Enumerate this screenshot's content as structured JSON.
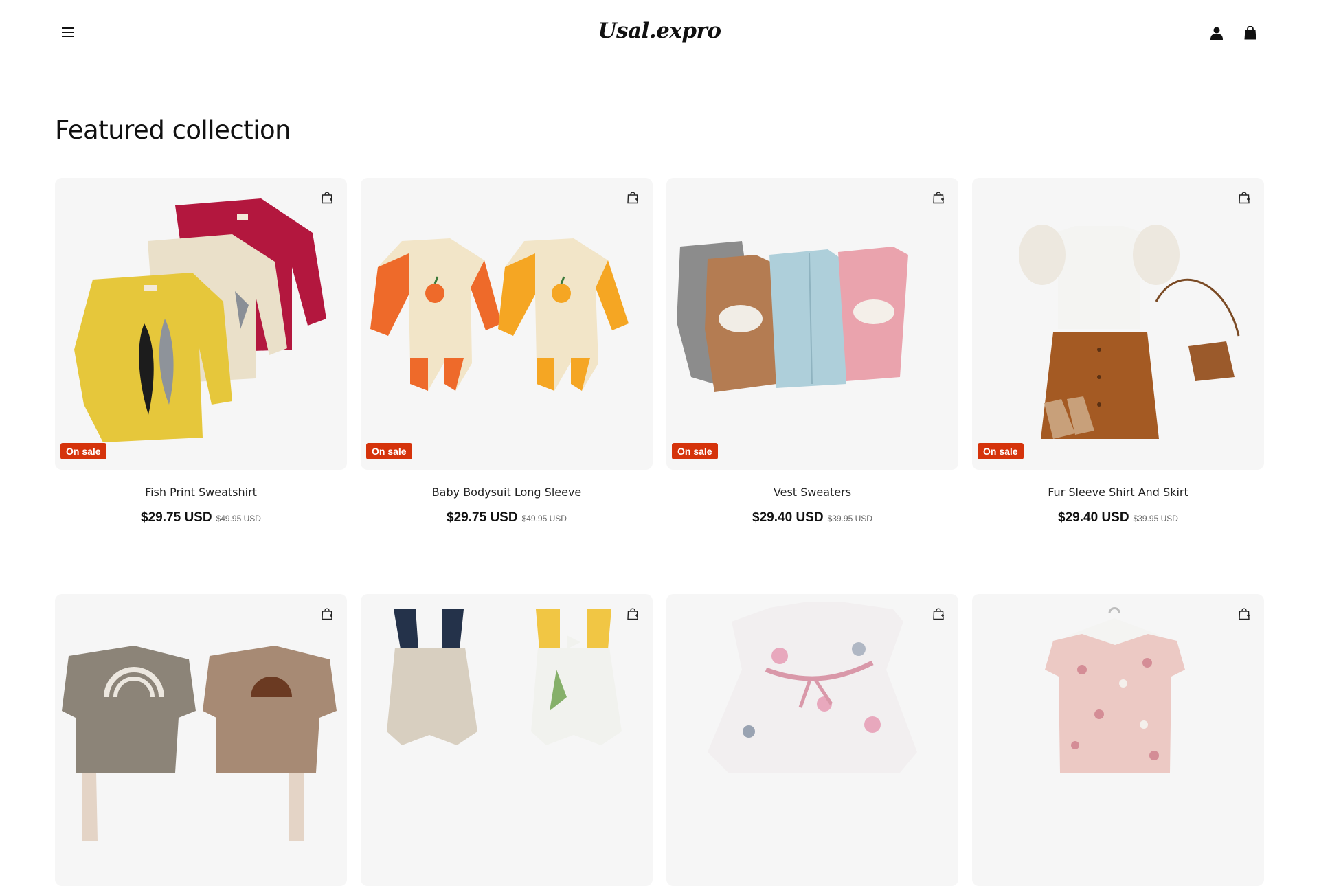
{
  "header": {
    "logo_text": "Usal.expro",
    "menu_icon": "hamburger-menu-icon",
    "account_icon": "account-icon",
    "cart_icon": "shopping-bag-icon"
  },
  "section": {
    "title": "Featured collection"
  },
  "colors": {
    "sale_badge": "#d5330b",
    "card_bg": "#f6f6f6",
    "text": "#111111"
  },
  "products": [
    {
      "title": "Fish Print Sweatshirt",
      "price": "$29.75 USD",
      "compare_price": "$49.95 USD",
      "badge": "On sale"
    },
    {
      "title": "Baby Bodysuit Long Sleeve",
      "price": "$29.75 USD",
      "compare_price": "$49.95 USD",
      "badge": "On sale"
    },
    {
      "title": "Vest Sweaters",
      "price": "$29.40 USD",
      "compare_price": "$39.95 USD",
      "badge": "On sale"
    },
    {
      "title": "Fur Sleeve Shirt And Skirt",
      "price": "$29.40 USD",
      "compare_price": "$39.95 USD",
      "badge": "On sale"
    },
    {
      "title": "",
      "price": "",
      "compare_price": "",
      "badge": ""
    },
    {
      "title": "",
      "price": "",
      "compare_price": "",
      "badge": ""
    },
    {
      "title": "",
      "price": "",
      "compare_price": "",
      "badge": ""
    },
    {
      "title": "",
      "price": "",
      "compare_price": "",
      "badge": ""
    }
  ],
  "product_images": [
    "sweatshirts-image",
    "bodysuits-image",
    "vest-sweaters-image",
    "shirt-skirt-set-image",
    "rainbow-sweatshirts-image",
    "floral-rompers-image",
    "floral-dress-image",
    "floral-top-image"
  ]
}
